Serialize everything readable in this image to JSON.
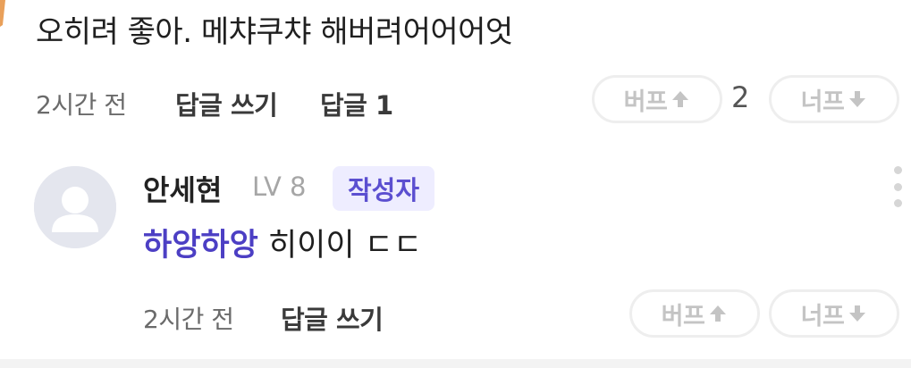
{
  "comment": {
    "text": "오히려 좋아. 메챠쿠챠 해버려어어어엇",
    "time": "2시간 전",
    "reply_write": "답글 쓰기",
    "reply_count_label": "답글 1",
    "upvote_label": "버프",
    "upvote_count": "2",
    "downvote_label": "너프"
  },
  "reply": {
    "author": "안세현",
    "level": "LV 8",
    "author_badge": "작성자",
    "mention": "하앙하앙",
    "text": " 히이이 ㄷㄷ",
    "time": "2시간 전",
    "reply_write": "답글 쓰기",
    "upvote_label": "버프",
    "downvote_label": "너프"
  },
  "colors": {
    "accent": "#4c3fc4",
    "badge_bg": "#eeedff",
    "pill_text": "#c4c4c4"
  },
  "icons": {
    "up": "arrow-up-icon",
    "down": "arrow-down-icon",
    "more": "more-vertical-icon",
    "avatar": "default-avatar-icon"
  }
}
